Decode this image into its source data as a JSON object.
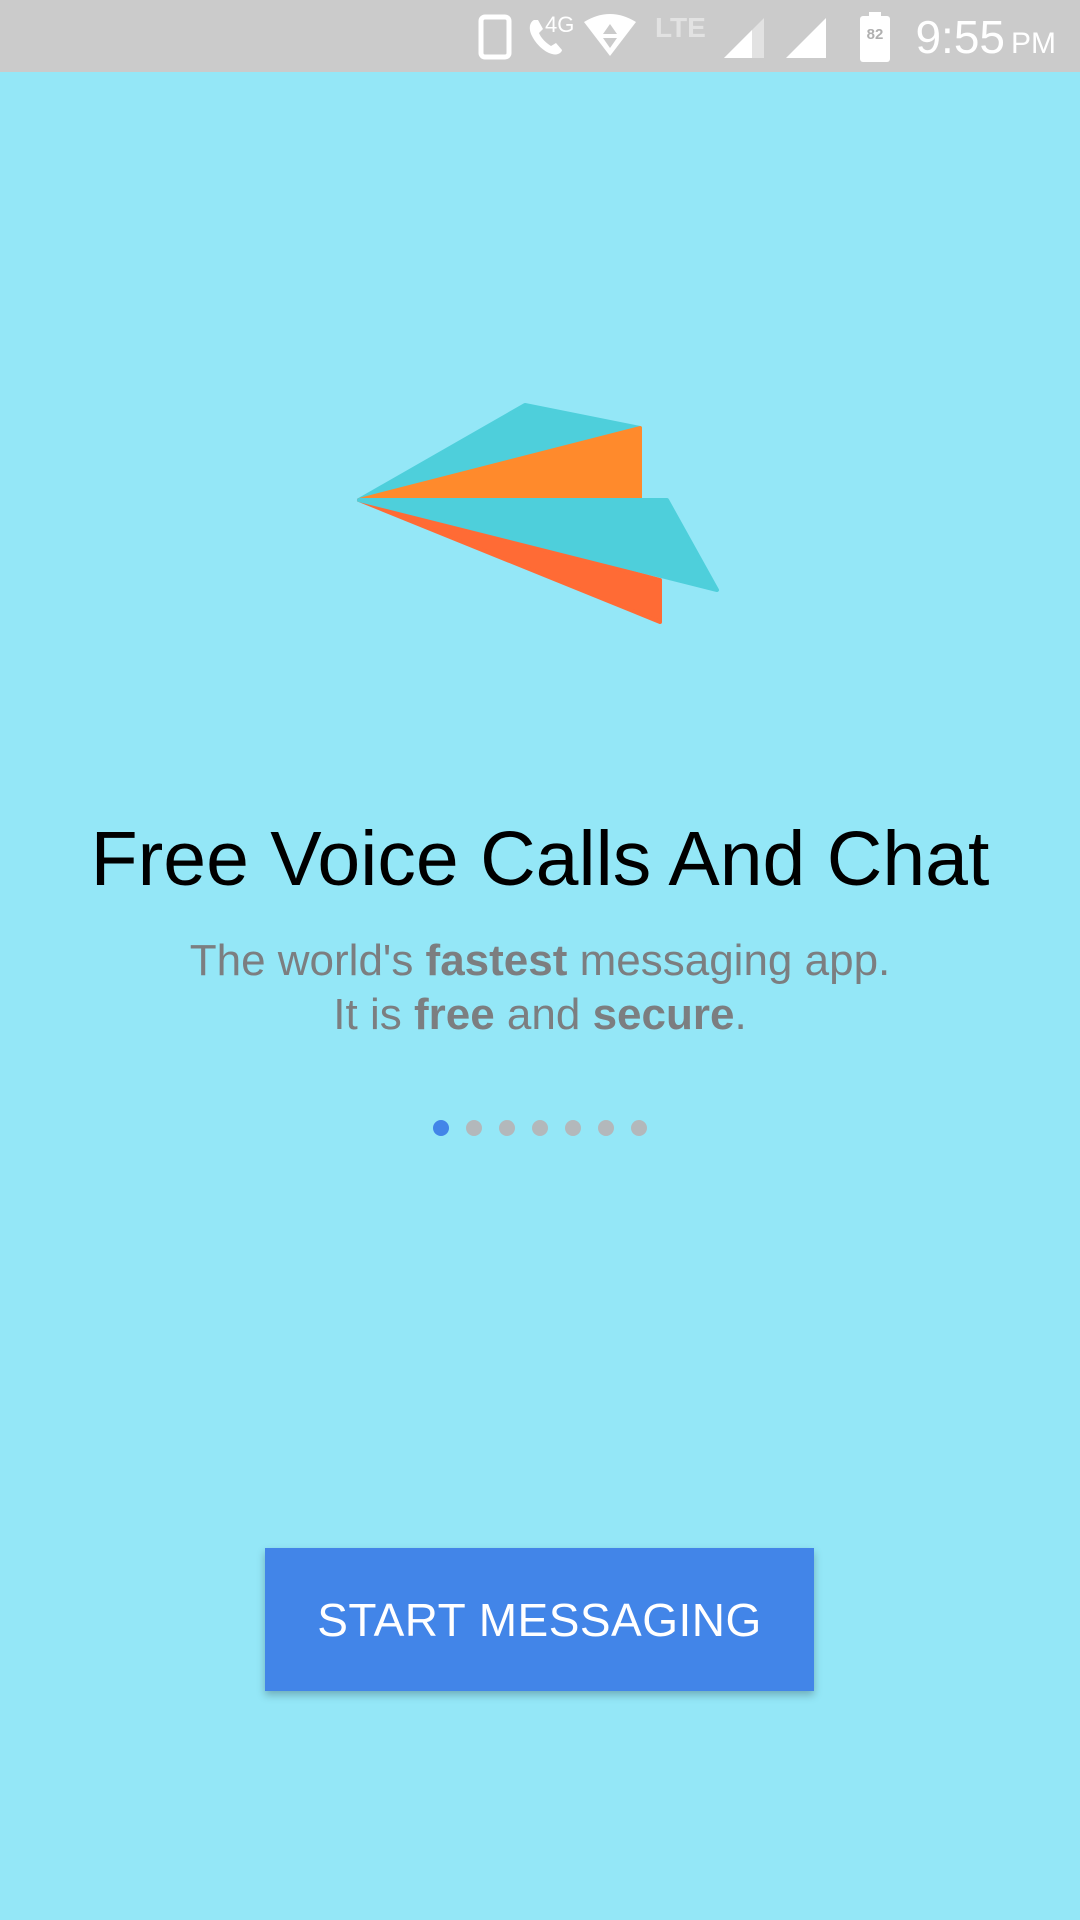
{
  "status_bar": {
    "time": "9:55",
    "ampm": "PM",
    "network_label": "4G",
    "lte_label": "LTE",
    "battery_level": "82",
    "icons": [
      "phone-icon",
      "call-icon",
      "wifi-icon",
      "signal-icon",
      "signal-icon",
      "battery-icon"
    ]
  },
  "onboarding": {
    "headline": "Free Voice Calls And Chat",
    "line1_pre": "The world's ",
    "line1_bold": "fastest",
    "line1_post": " messaging app.",
    "line2_pre": "It is ",
    "line2_bold1": "free",
    "line2_mid": " and ",
    "line2_bold2": "secure",
    "line2_post": ".",
    "page_count": 7,
    "active_page": 1
  },
  "start_button": {
    "label": "START MESSAGING"
  },
  "colors": {
    "background": "#94e7f7",
    "accent": "#4285e8",
    "status_bar": "#cbcbcb",
    "logo_teal": "#4ecfdb",
    "logo_orange": "#ff8a2c",
    "logo_red_orange": "#ff6b35"
  }
}
